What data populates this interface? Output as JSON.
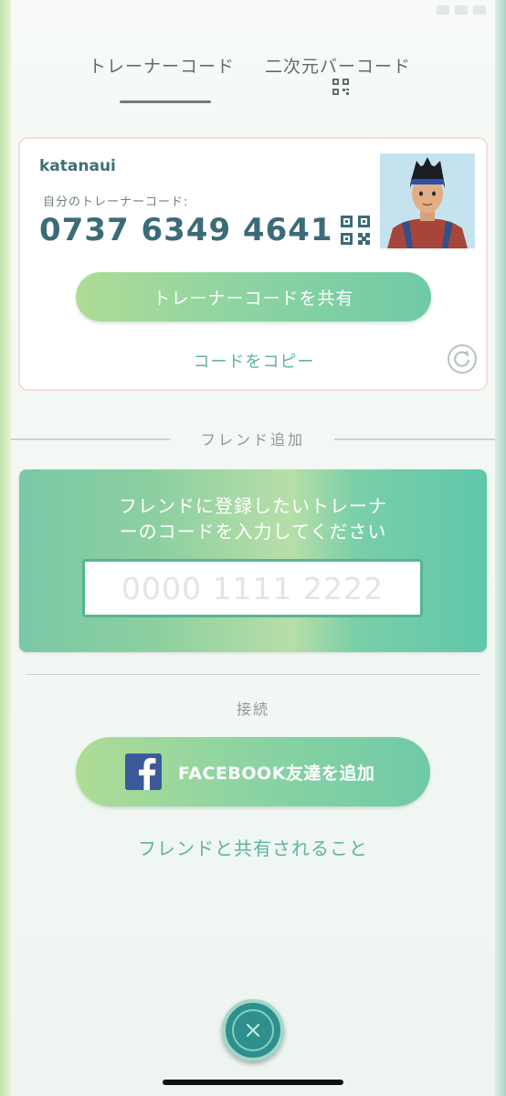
{
  "tabs": {
    "trainer_code": "トレーナーコード",
    "qr_code": "二次元バーコード"
  },
  "card": {
    "username": "katanaui",
    "code_label": "自分のトレーナーコード:",
    "code_value": "0737 6349 4641",
    "share_button": "トレーナーコードを共有",
    "copy_link": "コードをコピー"
  },
  "friend_add": {
    "heading": "フレンド追加",
    "instruction_line1": "フレンドに登録したいトレーナ",
    "instruction_line2": "ーのコードを入力してください",
    "input_placeholder": "0000 1111 2222",
    "input_value": ""
  },
  "connect": {
    "heading": "接続",
    "facebook_button": "FACEBOOK友達を追加",
    "share_info_link": "フレンドと共有されること"
  },
  "icons": {
    "tab_qr": "qr-code-icon",
    "card_qr": "qr-code-icon",
    "refresh": "refresh-icon",
    "facebook": "facebook-logo-icon",
    "close": "close-icon"
  },
  "colors": {
    "accent_green": "#5fb49a",
    "code_text": "#3c6b78",
    "facebook_blue": "#3c5a99",
    "close_teal": "#2f8f8d"
  }
}
